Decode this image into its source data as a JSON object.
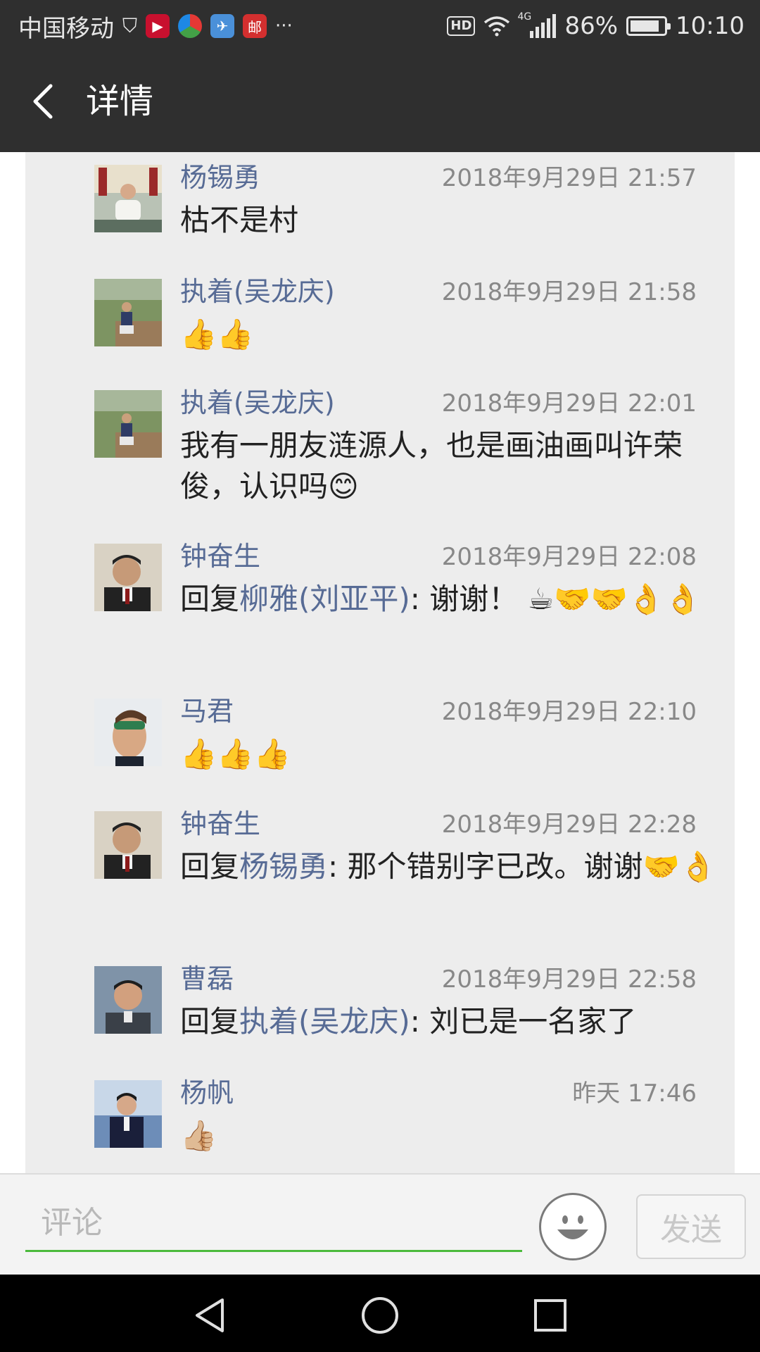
{
  "status_bar": {
    "carrier": "中国移动",
    "overflow": "···",
    "network": "4G",
    "battery": "86%",
    "battery_level": 0.86,
    "time": "10:10",
    "hd": "HD",
    "post_app_char": "邮"
  },
  "header": {
    "title": "详情",
    "back_icon": "back-arrow-icon"
  },
  "comments": [
    {
      "name": "杨锡勇",
      "time": "2018年9月29日 21:57",
      "text": "枯不是村"
    },
    {
      "name": "执着(吴龙庆)",
      "time": "2018年9月29日 21:58",
      "emoji": "👍👍"
    },
    {
      "name": "执着(吴龙庆)",
      "time": "2018年9月29日 22:01",
      "text": "我有一朋友涟源人，也是画油画叫许荣俊，认识吗😊"
    },
    {
      "name": "钟奋生",
      "time": "2018年9月29日 22:08",
      "reply_prefix": "回复",
      "reply_to": "柳雅(刘亚平)",
      "text": ": 谢谢！ ☕🤝🤝👌👌"
    },
    {
      "name": "马君",
      "time": "2018年9月29日 22:10",
      "emoji": "👍👍👍"
    },
    {
      "name": "钟奋生",
      "time": "2018年9月29日 22:28",
      "reply_prefix": "回复",
      "reply_to": "杨锡勇",
      "text": ": 那个错别字已改。谢谢🤝👌"
    },
    {
      "name": "曹磊",
      "time": "2018年9月29日 22:58",
      "reply_prefix": "回复",
      "reply_to": "执着(吴龙庆)",
      "text": ": 刘已是一名家了"
    },
    {
      "name": "杨帆",
      "time": "昨天 17:46",
      "emoji": "👍🏼"
    }
  ],
  "input_bar": {
    "placeholder": "评论",
    "send_label": "发送"
  },
  "colors": {
    "name_blue": "#576b95",
    "header_bg": "#2f2f2f",
    "input_underline": "#4bba3c"
  }
}
